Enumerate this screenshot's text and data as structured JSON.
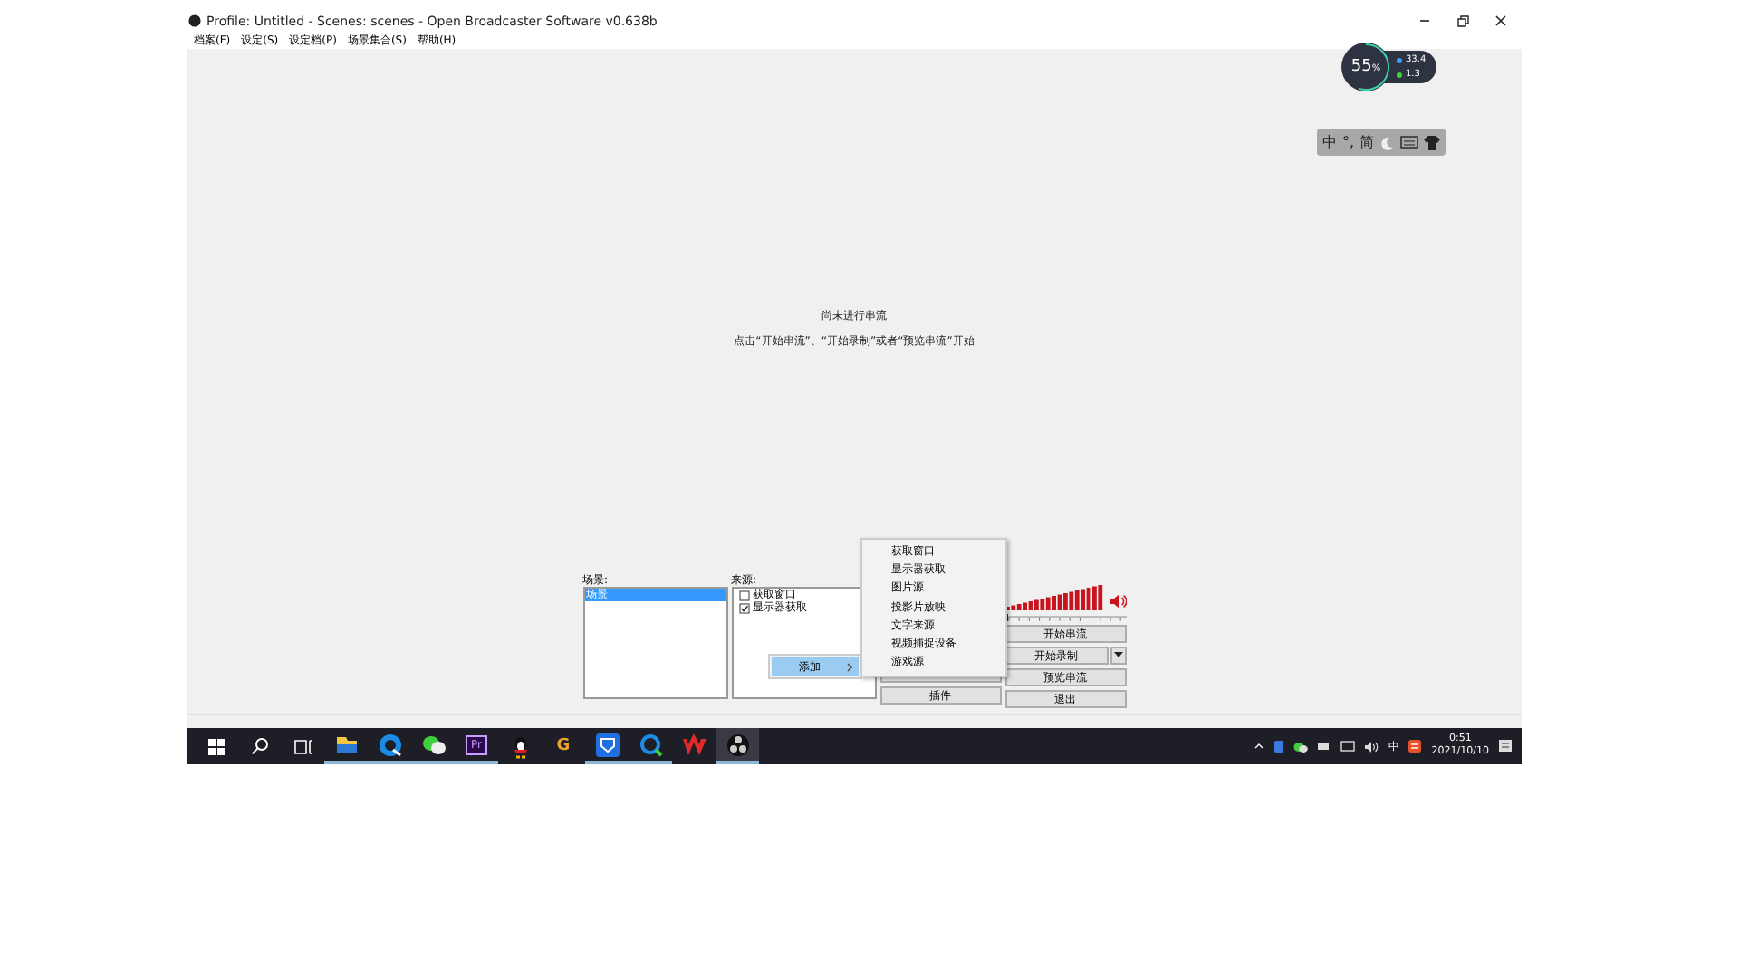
{
  "window": {
    "title": "Profile: Untitled - Scenes: scenes - Open Broadcaster Software v0.638b"
  },
  "menu_bar": {
    "items": [
      "档案(F)",
      "设定(S)",
      "设定档(P)",
      "场景集合(S)",
      "帮助(H)"
    ]
  },
  "monitor_widget": {
    "cpu": "55",
    "cpu_unit": "%",
    "level": 0.55,
    "upload": "33.4",
    "download": "1.3"
  },
  "ime_bar": {
    "items": [
      {
        "kind": "text",
        "label": "中"
      },
      {
        "kind": "text",
        "label": "°,"
      },
      {
        "kind": "text",
        "label": "简"
      },
      {
        "kind": "moon"
      },
      {
        "kind": "keyboard"
      },
      {
        "kind": "shirt"
      }
    ]
  },
  "preview": {
    "status": "尚未进行串流",
    "hint": "点击“开始串流”、“开始录制”或者“预览串流”开始"
  },
  "scenes": {
    "label": "场景:",
    "items": [
      {
        "label": "场景",
        "selected": true
      }
    ]
  },
  "sources": {
    "label": "来源:",
    "items": [
      {
        "label": "获取窗口",
        "checked": false
      },
      {
        "label": "显示器获取",
        "checked": true
      }
    ]
  },
  "middle_buttons": [
    {
      "kind": "blank"
    },
    {
      "kind": "text",
      "label": "插件"
    }
  ],
  "volume": {
    "level": 0.0
  },
  "right_buttons": [
    {
      "label": "开始串流",
      "dropdown": false
    },
    {
      "label": "开始录制",
      "dropdown": true
    },
    {
      "label": "预览串流",
      "dropdown": false
    },
    {
      "label": "退出",
      "dropdown": false
    }
  ],
  "context_menu": {
    "items": [
      {
        "label": "添加",
        "submenu": true,
        "selected": true
      }
    ]
  },
  "submenu": {
    "items": [
      "获取窗口",
      "显示器获取",
      "图片源",
      "投影片放映",
      "文字来源",
      "视频捕捉设备",
      "游戏源"
    ]
  },
  "taskbar": {
    "apps": [
      {
        "kind": "start",
        "running": false
      },
      {
        "kind": "search",
        "running": false
      },
      {
        "kind": "taskview",
        "running": false
      },
      {
        "kind": "folder",
        "running": true
      },
      {
        "kind": "browser",
        "running": true
      },
      {
        "kind": "chat",
        "running": true
      },
      {
        "kind": "premiere",
        "label": "Pr",
        "running": true
      },
      {
        "kind": "penguin",
        "running": false
      },
      {
        "kind": "letter",
        "label": "G",
        "running": false
      },
      {
        "kind": "shield",
        "running": true
      },
      {
        "kind": "magnifier",
        "running": true
      },
      {
        "kind": "wps",
        "running": false
      },
      {
        "kind": "obs",
        "running": true,
        "selected": true
      }
    ],
    "tray": {
      "ime": "中",
      "time": "0:51",
      "date": "2021/10/10"
    }
  }
}
